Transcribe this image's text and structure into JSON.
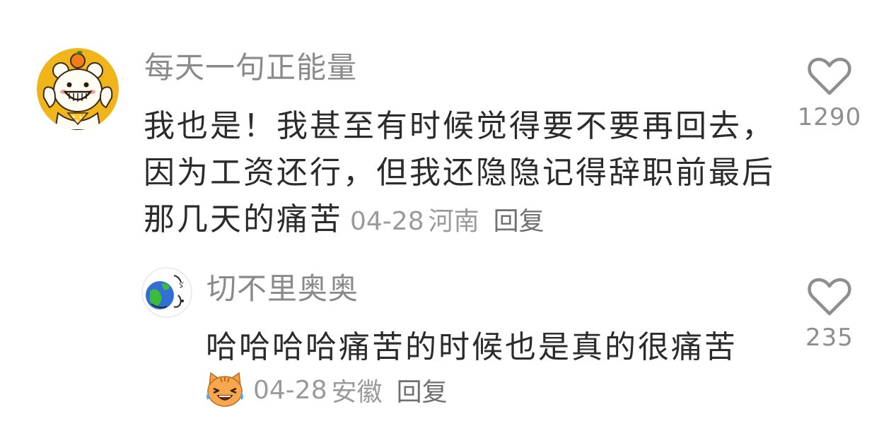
{
  "comments": [
    {
      "username": "每天一句正能量",
      "text": "我也是！我甚至有时候觉得要不要再回去，因为工资还行，但我还隐隐记得辞职前最后那几天的痛苦",
      "date": "04-28",
      "region": "河南",
      "reply_label": "回复",
      "likes": "1290",
      "avatar_icon": "bear-avatar",
      "like_icon": "heart-outline-icon"
    }
  ],
  "replies": [
    {
      "username": "切不里奥奥",
      "text": "哈哈哈哈痛苦的时候也是真的很痛苦",
      "emoji_icon": "crying-laughing-cat-emoji",
      "date": "04-28",
      "region": "安徽",
      "reply_label": "回复",
      "likes": "235",
      "avatar_icon": "globe-sketch-avatar",
      "like_icon": "heart-outline-icon"
    }
  ],
  "colors": {
    "username": "#8a8a8a",
    "text": "#2b2b2b",
    "meta": "#9a9a9a",
    "avatar_bg": "#f1b51c"
  }
}
